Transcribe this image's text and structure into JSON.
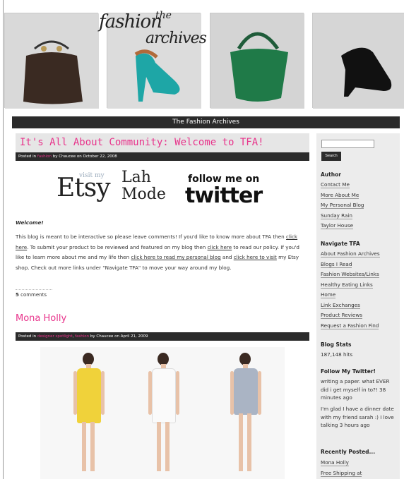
{
  "site": {
    "logo_word1": "fashion",
    "logo_word2": "the",
    "logo_word3": "archives",
    "nav_title": "The Fashion Archives"
  },
  "posts": [
    {
      "title": "It's All About Community: Welcome to TFA!",
      "meta_prefix": "Posted in ",
      "meta_category": "fashion",
      "meta_suffix": " by Chaucee on October 22, 2008",
      "logos": {
        "etsy_small": "visit my",
        "etsy": "Etsy",
        "lah1": "Lah",
        "lah2": "Mode",
        "twitter_top": "follow me on",
        "twitter_big": "twitter"
      },
      "welcome": "Welcome!",
      "para_1": "This blog is meant to be interactive so please leave comments! If you'd like to know more about TFA then ",
      "link_1": "click here",
      "para_2": ". To submit your product to be reviewed and featured on my blog then ",
      "link_2": "click here",
      "para_3": " to read our policy. If you'd like to learn more about me and my life then ",
      "link_3": "click here to read my personal blog",
      "para_4": " and ",
      "link_4": "click here to visit",
      "para_5": " my Etsy shop. Check out more links under \"Navigate TFA\" to move your way around my blog.",
      "comments_count": "5",
      "comments_label": " comments"
    },
    {
      "title": "Mona Holly",
      "meta_prefix": "Posted in ",
      "meta_category": "designer spotlight",
      "meta_sep": ", ",
      "meta_category2": "fashion",
      "meta_suffix": " by Chaucee on April 21, 2009"
    }
  ],
  "sidebar": {
    "search_button": "Search",
    "author_heading": "Author",
    "author_links": [
      "Contact Me",
      "More About Me",
      "My Personal Blog",
      "Sunday Rain",
      "Taylor House"
    ],
    "navigate_heading": "Navigate TFA",
    "navigate_links": [
      "About Fashion Archives",
      "Blogs I Read",
      "Fashion Websites/Links",
      "Healthy Eating Links",
      "Home",
      "Link Exchanges",
      "Product Reviews",
      "Request a Fashion Find"
    ],
    "stats_heading": "Blog Stats",
    "stats_value": "187,148 hits",
    "twitter_heading": "Follow My Twitter!",
    "tweet_1": "writing a paper. what EVER did i get myself in to?! 38 minutes ago",
    "tweet_2": "I'm glad I have a dinner date with my friend sarah :) I love talking 3 hours ago",
    "recent_heading": "Recently Posted...",
    "recent_links": [
      "Mona Holly",
      "Free Shipping at"
    ]
  },
  "colors": {
    "accent_pink": "#e8338b",
    "dark_bar": "#2b2b2b",
    "sidebar_bg": "#ececec",
    "dress_yellow": "#f0d23a",
    "dress_white": "#fafafa",
    "dress_gray": "#aab4c4"
  }
}
